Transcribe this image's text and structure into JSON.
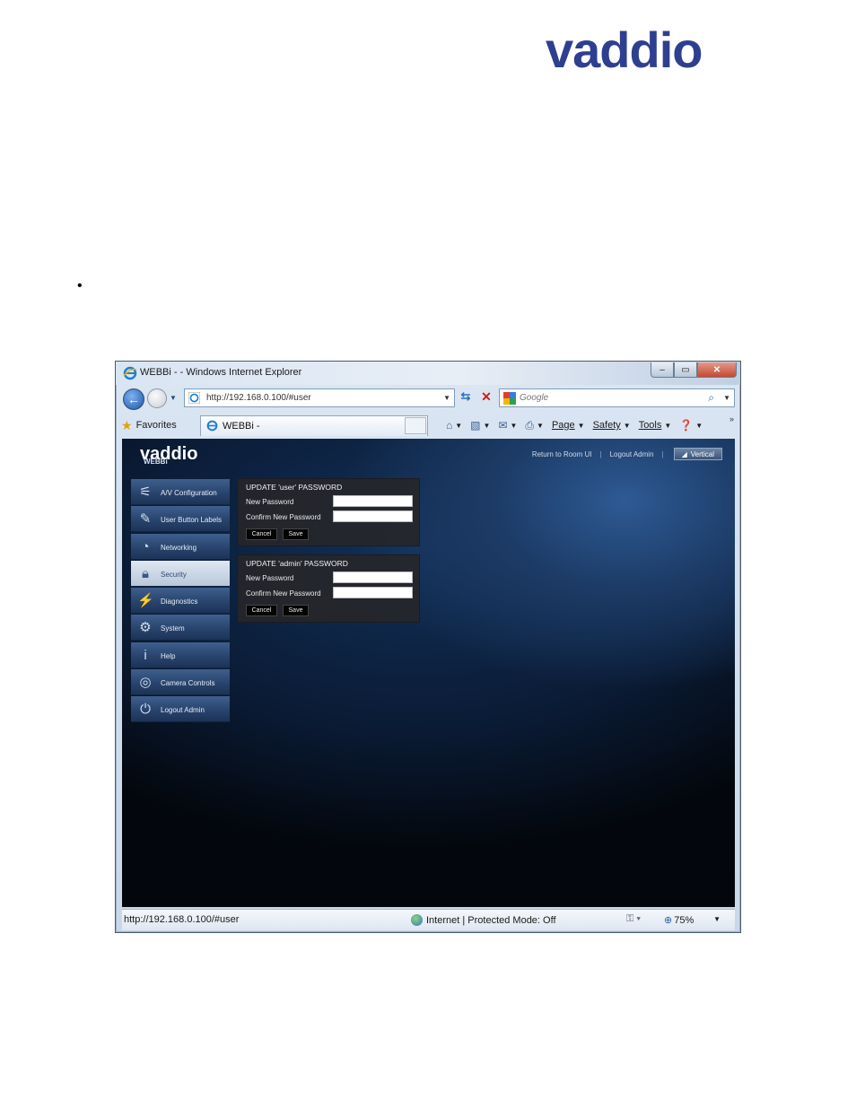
{
  "page": {
    "logo": "vaddio",
    "bullet": "•"
  },
  "browser": {
    "window_title": "WEBBi - - Windows Internet Explorer",
    "controls": {
      "minimize": "–",
      "restore": "▭",
      "close": "✕"
    },
    "address": "http://192.168.0.100/#user",
    "search_placeholder": "Google",
    "favorites_label": "Favorites",
    "tab_title": "WEBBi -",
    "toolbar": {
      "page": "Page",
      "safety": "Safety",
      "tools": "Tools"
    },
    "status": {
      "url": "http://192.168.0.100/#user",
      "zone": "Internet | Protected Mode: Off",
      "zoom": "75%"
    }
  },
  "app": {
    "logo": "vaddio",
    "subtitle": "WEBBi",
    "header_links": {
      "return": "Return to Room UI",
      "logout": "Logout Admin",
      "vertical": "Vertical"
    },
    "sidebar": [
      {
        "label": "A/V Configuration",
        "icon": "av-config-icon",
        "active": false
      },
      {
        "label": "User Button Labels",
        "icon": "pencil-icon",
        "active": false
      },
      {
        "label": "Networking",
        "icon": "network-icon",
        "active": false
      },
      {
        "label": "Security",
        "icon": "lock-icon",
        "active": true
      },
      {
        "label": "Diagnostics",
        "icon": "pulse-icon",
        "active": false
      },
      {
        "label": "System",
        "icon": "gear-icon",
        "active": false
      },
      {
        "label": "Help",
        "icon": "info-icon",
        "active": false
      },
      {
        "label": "Camera Controls",
        "icon": "camera-icon",
        "active": false
      },
      {
        "label": "Logout Admin",
        "icon": "power-icon",
        "active": false
      }
    ],
    "user_panel": {
      "title": "UPDATE 'user' PASSWORD",
      "new_label": "New Password",
      "confirm_label": "Confirm New Password",
      "cancel": "Cancel",
      "save": "Save"
    },
    "admin_panel": {
      "title": "UPDATE 'admin' PASSWORD",
      "new_label": "New Password",
      "confirm_label": "Confirm New Password",
      "cancel": "Cancel",
      "save": "Save"
    }
  }
}
